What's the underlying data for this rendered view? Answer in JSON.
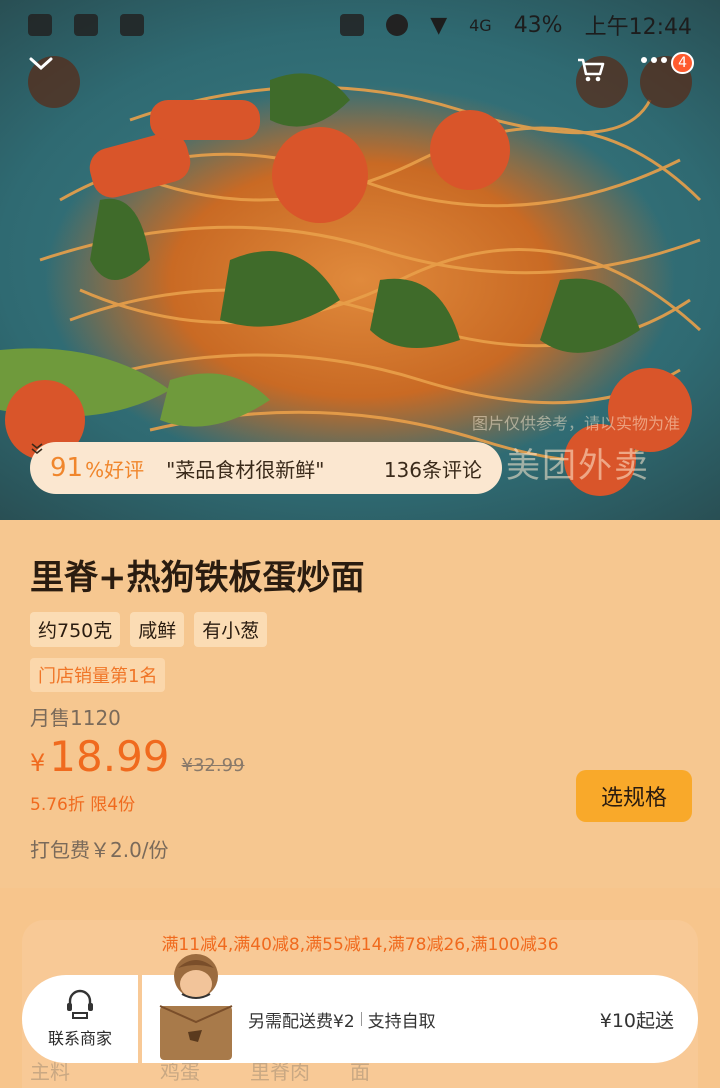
{
  "status_bar": {
    "signal": "4G",
    "battery": "43%",
    "time": "上午12:44"
  },
  "hero": {
    "rating_percent": "91",
    "rating_label": "%好评",
    "quote": "\"菜品食材很新鲜\"",
    "reviews": "136条评论",
    "cart_badge": "4",
    "disclaimer": "图片仅供参考，请以实物为准",
    "watermark": "美团外卖"
  },
  "product": {
    "title": "里脊+热狗铁板蛋炒面",
    "tags": [
      "约750克",
      "咸鲜",
      "有小葱"
    ],
    "rank": "门店销量第1名",
    "monthly_sales": "月售1120",
    "currency": "¥",
    "price": "18.99",
    "original_price": "¥32.99",
    "discount": "5.76折  限4份",
    "packing_fee": "打包费￥2.0/份",
    "select_spec": "选规格"
  },
  "promo": "满11减4,满40减8,满55减14,满78减26,满100减36",
  "background_text": {
    "left": "主料",
    "mid": "鸡蛋",
    "right": "里脊肉",
    "far": "面"
  },
  "cart_bar": {
    "contact_label": "联系商家",
    "delivery": "另需配送费¥2",
    "pickup": "支持自取",
    "min_order": "¥10起送"
  },
  "colors": {
    "accent": "#f06a1e",
    "button": "#f9a92a",
    "background": "#f6c790"
  }
}
